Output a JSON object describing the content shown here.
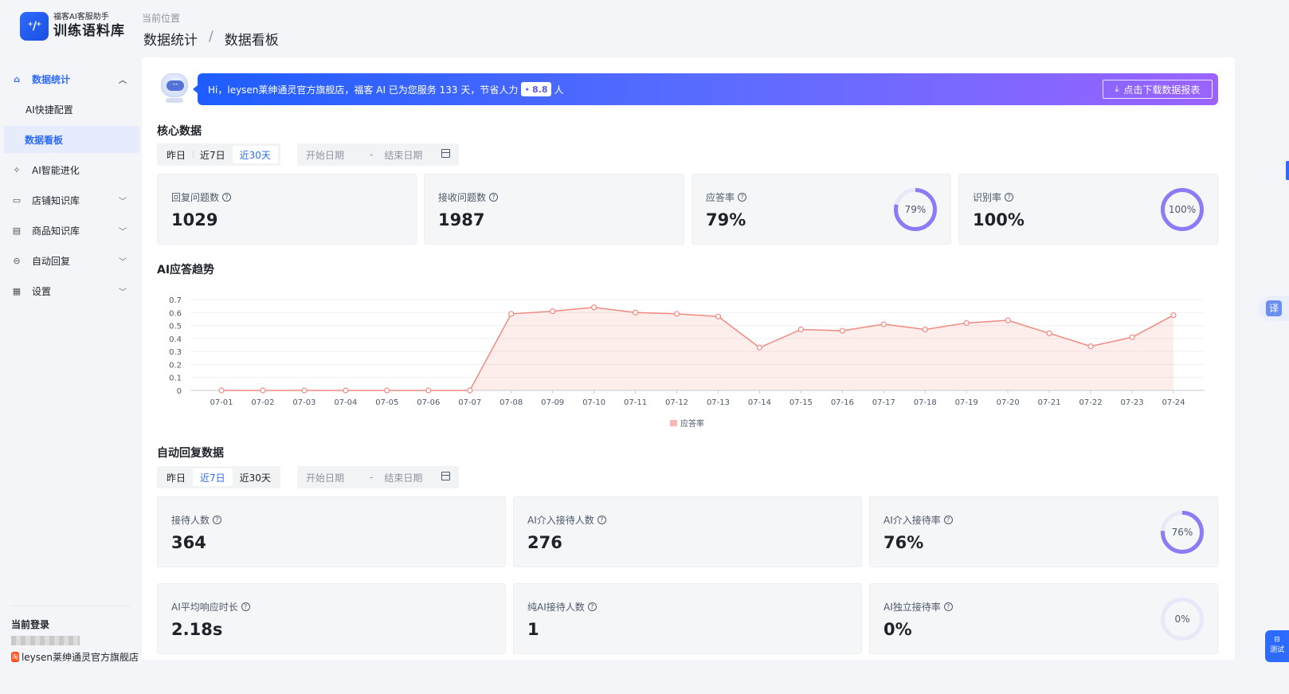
{
  "app": {
    "logo_mark": "⁺/⁺",
    "logo_sub": "福客AI客服助手",
    "logo_title": "训练语料库"
  },
  "sidebar": {
    "groups": [
      {
        "label": "数据统计",
        "icon": "home-icon",
        "expanded": true
      },
      {
        "label": "AI智能进化",
        "icon": "sparkle-icon"
      },
      {
        "label": "店铺知识库",
        "icon": "book-icon"
      },
      {
        "label": "商品知识库",
        "icon": "box-icon"
      },
      {
        "label": "自动回复",
        "icon": "robot-icon"
      },
      {
        "label": "设置",
        "icon": "grid-icon"
      }
    ],
    "sub_items": [
      {
        "label": "AI快捷配置"
      },
      {
        "label": "数据看板",
        "selected": true
      }
    ],
    "login_title": "当前登录",
    "store_name": "leysen莱绅通灵官方旗舰店",
    "store_badge": "淘"
  },
  "header": {
    "location_label": "当前位置",
    "breadcrumb": [
      "数据统计",
      "数据看板"
    ],
    "separator": "/"
  },
  "banner": {
    "text_before": "Hi，leysen莱绅通灵官方旗舰店，福客 AI 已为您服务 133 天，节省人力",
    "saved_value": "8.8",
    "text_after": "人",
    "download_label": "点击下载数据报表"
  },
  "core": {
    "title": "核心数据",
    "tabs": [
      "昨日",
      "近7日",
      "近30天"
    ],
    "active_tab": 2,
    "start_placeholder": "开始日期",
    "range_sep": "-",
    "end_placeholder": "结束日期",
    "cards": [
      {
        "label": "回复问题数",
        "value": "1029"
      },
      {
        "label": "接收问题数",
        "value": "1987"
      },
      {
        "label": "应答率",
        "value": "79%",
        "ring_text": "79%",
        "ring_fraction": 0.79
      },
      {
        "label": "识别率",
        "value": "100%",
        "ring_text": "100%",
        "ring_fraction": 1.0
      }
    ]
  },
  "trend": {
    "title": "AI应答趋势"
  },
  "chart_data": {
    "type": "area",
    "title": "",
    "xlabel": "",
    "ylabel": "",
    "ylim": [
      0,
      0.7
    ],
    "yticks": [
      "0",
      "0.1",
      "0.2",
      "0.3",
      "0.4",
      "0.5",
      "0.6",
      "0.7"
    ],
    "grid": true,
    "legend": "bottom-center",
    "categories": [
      "07-01",
      "07-02",
      "07-03",
      "07-04",
      "07-05",
      "07-06",
      "07-07",
      "07-08",
      "07-09",
      "07-10",
      "07-11",
      "07-12",
      "07-13",
      "07-14",
      "07-15",
      "07-16",
      "07-17",
      "07-18",
      "07-19",
      "07-20",
      "07-21",
      "07-22",
      "07-23",
      "07-24"
    ],
    "series": [
      {
        "name": "应答率",
        "color": "#f08a80",
        "values": [
          0,
          0,
          0,
          0,
          0,
          0,
          0,
          0.59,
          0.61,
          0.64,
          0.6,
          0.59,
          0.57,
          0.33,
          0.47,
          0.46,
          0.51,
          0.47,
          0.52,
          0.54,
          0.44,
          0.34,
          0.41,
          0.58
        ]
      }
    ]
  },
  "auto_reply": {
    "title": "自动回复数据",
    "tabs": [
      "昨日",
      "近7日",
      "近30天"
    ],
    "active_tab": 1,
    "start_placeholder": "开始日期",
    "range_sep": "-",
    "end_placeholder": "结束日期",
    "cards": [
      {
        "label": "接待人数",
        "value": "364"
      },
      {
        "label": "AI介入接待人数",
        "value": "276"
      },
      {
        "label": "AI介入接待率",
        "value": "76%",
        "ring_text": "76%",
        "ring_fraction": 0.76
      },
      {
        "label": "AI平均响应时长",
        "value": "2.18s"
      },
      {
        "label": "纯AI接待人数",
        "value": "1"
      },
      {
        "label": "AI独立接待率",
        "value": "0%",
        "ring_text": "0%",
        "ring_fraction": 0.0
      }
    ]
  },
  "widgets": {
    "translate_label": "译",
    "test_label": "测试"
  },
  "colors": {
    "accent": "#2d6bff",
    "ring": "#8b7cf6",
    "ring_track": "#e6eaf8",
    "line": "#f08a80"
  }
}
